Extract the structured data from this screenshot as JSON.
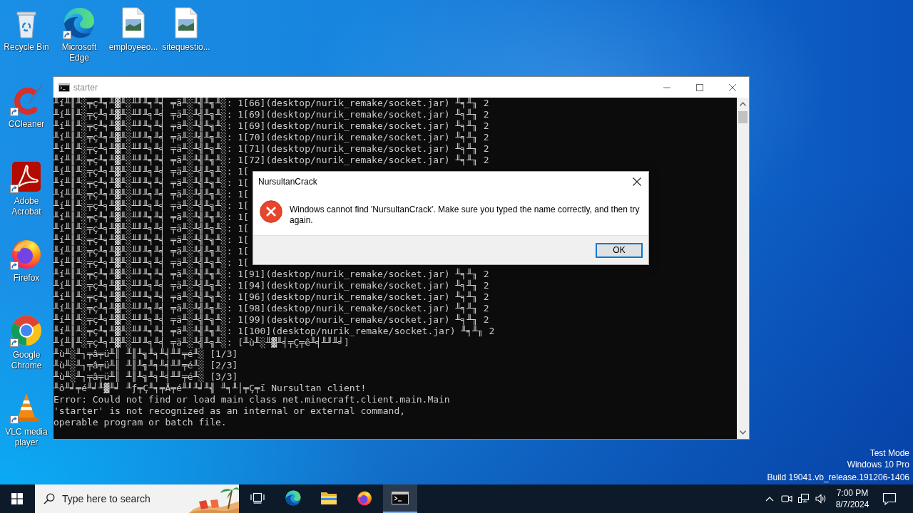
{
  "desktop": {
    "icons": [
      {
        "label": "Recycle Bin",
        "kind": "recycle-bin",
        "shortcut": false
      },
      {
        "label": "Microsoft Edge",
        "kind": "edge",
        "shortcut": true
      },
      {
        "label": "employeeo...",
        "kind": "image-file",
        "shortcut": false
      },
      {
        "label": "sitequestio...",
        "kind": "image-file",
        "shortcut": false
      },
      {
        "label": "CCleaner",
        "kind": "ccleaner",
        "shortcut": true
      },
      {
        "label": "Adobe Acrobat",
        "kind": "acrobat",
        "shortcut": true
      },
      {
        "label": "Firefox",
        "kind": "firefox",
        "shortcut": true
      },
      {
        "label": "Google Chrome",
        "kind": "chrome",
        "shortcut": true
      },
      {
        "label": "VLC media player",
        "kind": "vlc",
        "shortcut": true
      }
    ]
  },
  "console_window": {
    "title": "starter",
    "lines": [
      "╨í╨║╨░╤ç╨╕╨▓╨░╨╜╨╕╨╡ ╤ä╨░╨╣╨╗╨░: 1[66](desktop/nurik_remake/socket.jar) ╨╕╨╖ 2",
      "╨í╨║╨░╤ç╨╕╨▓╨░╨╜╨╕╨╡ ╤ä╨░╨╣╨╗╨░: 1[69](desktop/nurik_remake/socket.jar) ╨╕╨╖ 2",
      "╨í╨║╨░╤ç╨╕╨▓╨░╨╜╨╕╨╡ ╤ä╨░╨╣╨╗╨░: 1[69](desktop/nurik_remake/socket.jar) ╨╕╨╖ 2",
      "╨í╨║╨░╤ç╨╕╨▓╨░╨╜╨╕╨╡ ╤ä╨░╨╣╨╗╨░: 1[70](desktop/nurik_remake/socket.jar) ╨╕╨╖ 2",
      "╨í╨║╨░╤ç╨╕╨▓╨░╨╜╨╕╨╡ ╤ä╨░╨╣╨╗╨░: 1[71](desktop/nurik_remake/socket.jar) ╨╕╨╖ 2",
      "╨í╨║╨░╤ç╨╕╨▓╨░╨╜╨╕╨╡ ╤ä╨░╨╣╨╗╨░: 1[72](desktop/nurik_remake/socket.jar) ╨╕╨╖ 2",
      "╨í╨║╨░╤ç╨╕╨▓╨░╨╜╨╕╨╡ ╤ä╨░╨╣╨╗╨░: 1[",
      "╨í╨║╨░╤ç╨╕╨▓╨░╨╜╨╕╨╡ ╤ä╨░╨╣╨╗╨░: 1[",
      "╨í╨║╨░╤ç╨╕╨▓╨░╨╜╨╕╨╡ ╤ä╨░╨╣╨╗╨░: 1[",
      "╨í╨║╨░╤ç╨╕╨▓╨░╨╜╨╕╨╡ ╤ä╨░╨╣╨╗╨░: 1[",
      "╨í╨║╨░╤ç╨╕╨▓╨░╨╜╨╕╨╡ ╤ä╨░╨╣╨╗╨░: 1[",
      "╨í╨║╨░╤ç╨╕╨▓╨░╨╜╨╕╨╡ ╤ä╨░╨╣╨╗╨░: 1[",
      "╨í╨║╨░╤ç╨╕╨▓╨░╨╜╨╕╨╡ ╤ä╨░╨╣╨╗╨░: 1[",
      "╨í╨║╨░╤ç╨╕╨▓╨░╨╜╨╕╨╡ ╤ä╨░╨╣╨╗╨░: 1[",
      "╨í╨║╨░╤ç╨╕╨▓╨░╨╜╨╕╨╡ ╤ä╨░╨╣╨╗╨░: 1[",
      "╨í╨║╨░╤ç╨╕╨▓╨░╨╜╨╕╨╡ ╤ä╨░╨╣╨╗╨░: 1[91](desktop/nurik_remake/socket.jar) ╨╕╨╖ 2",
      "╨í╨║╨░╤ç╨╕╨▓╨░╨╜╨╕╨╡ ╤ä╨░╨╣╨╗╨░: 1[94](desktop/nurik_remake/socket.jar) ╨╕╨╖ 2",
      "╨í╨║╨░╤ç╨╕╨▓╨░╨╜╨╕╨╡ ╤ä╨░╨╣╨╗╨░: 1[96](desktop/nurik_remake/socket.jar) ╨╕╨╖ 2",
      "╨í╨║╨░╤ç╨╕╨▓╨░╨╜╨╕╨╡ ╤ä╨░╨╣╨╗╨░: 1[98](desktop/nurik_remake/socket.jar) ╨╕╨╖ 2",
      "╨í╨║╨░╤ç╨╕╨▓╨░╨╜╨╕╨╡ ╤ä╨░╨╣╨╗╨░: 1[99](desktop/nurik_remake/socket.jar) ╨╕╨╖ 2",
      "╨í╨║╨░╤ç╨╕╨▓╨░╨╜╨╕╨╡ ╤ä╨░╨╣╨╗╨░: 1[100](desktop/nurik_remake/socket.jar) ╨╕╨╖ 2",
      "╨í╨║╨░╤ç╨╕╨▓╨░╨╜╨╕╨╡ ╤ä╨░╨╣╨╗╨░: [╨ù╨░╨▓╨╡╤Ç╤ê╨╡╨╜╨╛]",
      "╨ù╨░╨┐╤â╤ü╨║ ╨║╨╗╨╕╨╡╨╜╤é╨░ [1/3]",
      "╨ù╨░╨┐╤â╤ü╨║ ╨║╨╗╨╕╨╡╨╜╤é╨░ [2/3]",
      "╨ù╨░╨┐╤â╤ü╨║ ╨║╨╗╨╕╨╡╨╜╤é╨░ [3/3]",
      "╨ô╨╛╤é╨╛╨▓╨╛ ╨ƒ╤Ç╨╕╤Å╤é╨╜╨╛╨╣ ╨╕╨│╤Ç╤ï Nursultan client!",
      "Error: Could not find or load main class net.minecraft.client.main.Main",
      "'starter' is not recognized as an internal or external command,",
      "operable program or batch file."
    ]
  },
  "dialog": {
    "title": "NursultanCrack",
    "message": "Windows cannot find 'NursultanCrack'. Make sure you typed the name correctly, and then try again.",
    "buttons": [
      {
        "label": "OK",
        "default": true
      }
    ]
  },
  "system_info": [
    "Test Mode",
    "Windows 10 Pro",
    "Build 19041.vb_release.191206-1406"
  ],
  "taskbar": {
    "search": {
      "placeholder": "Type here to search"
    },
    "apps": [
      {
        "kind": "task-view",
        "selected": false
      },
      {
        "kind": "edge",
        "selected": false
      },
      {
        "kind": "explorer",
        "selected": false
      },
      {
        "kind": "firefox",
        "selected": false
      },
      {
        "kind": "console",
        "selected": true
      }
    ],
    "clock": {
      "time": "7:00 PM",
      "date": "8/7/2024"
    }
  }
}
